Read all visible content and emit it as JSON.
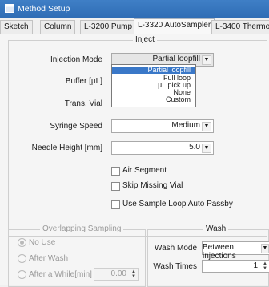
{
  "window": {
    "title": "Method Setup"
  },
  "tabs": [
    "Sketch",
    "Column",
    "L-3200 Pump",
    "L-3320 AutoSampler",
    "L-3400 Thermost"
  ],
  "inject": {
    "group_title": "Inject",
    "injection_mode": {
      "label": "Injection Mode",
      "value": "Partial loopfill"
    },
    "mode_options": [
      "Partial loopfill",
      "Full loop",
      "µL pick up",
      "None",
      "Custom"
    ],
    "buffer_label": "Buffer  [µL]",
    "trans_vial_label": "Trans. Vial",
    "syringe_speed": {
      "label": "Syringe Speed",
      "value": "Medium"
    },
    "needle_height": {
      "label": "Needle Height [mm]",
      "value": "5.0"
    },
    "air_segment": "Air Segment",
    "skip_missing_vial": "Skip Missing Vial",
    "sample_loop_passby": "Use Sample Loop Auto Passby"
  },
  "overlap": {
    "group_title": "Overlapping Sampling",
    "no_use": "No Use",
    "after_wash": "After Wash",
    "after_while": "After a While[min]",
    "after_while_value": "0.00"
  },
  "wash": {
    "group_title": "Wash",
    "mode_label": "Wash Mode",
    "mode_value": "Between injections",
    "times_label": "Wash Times",
    "times_value": "1"
  }
}
